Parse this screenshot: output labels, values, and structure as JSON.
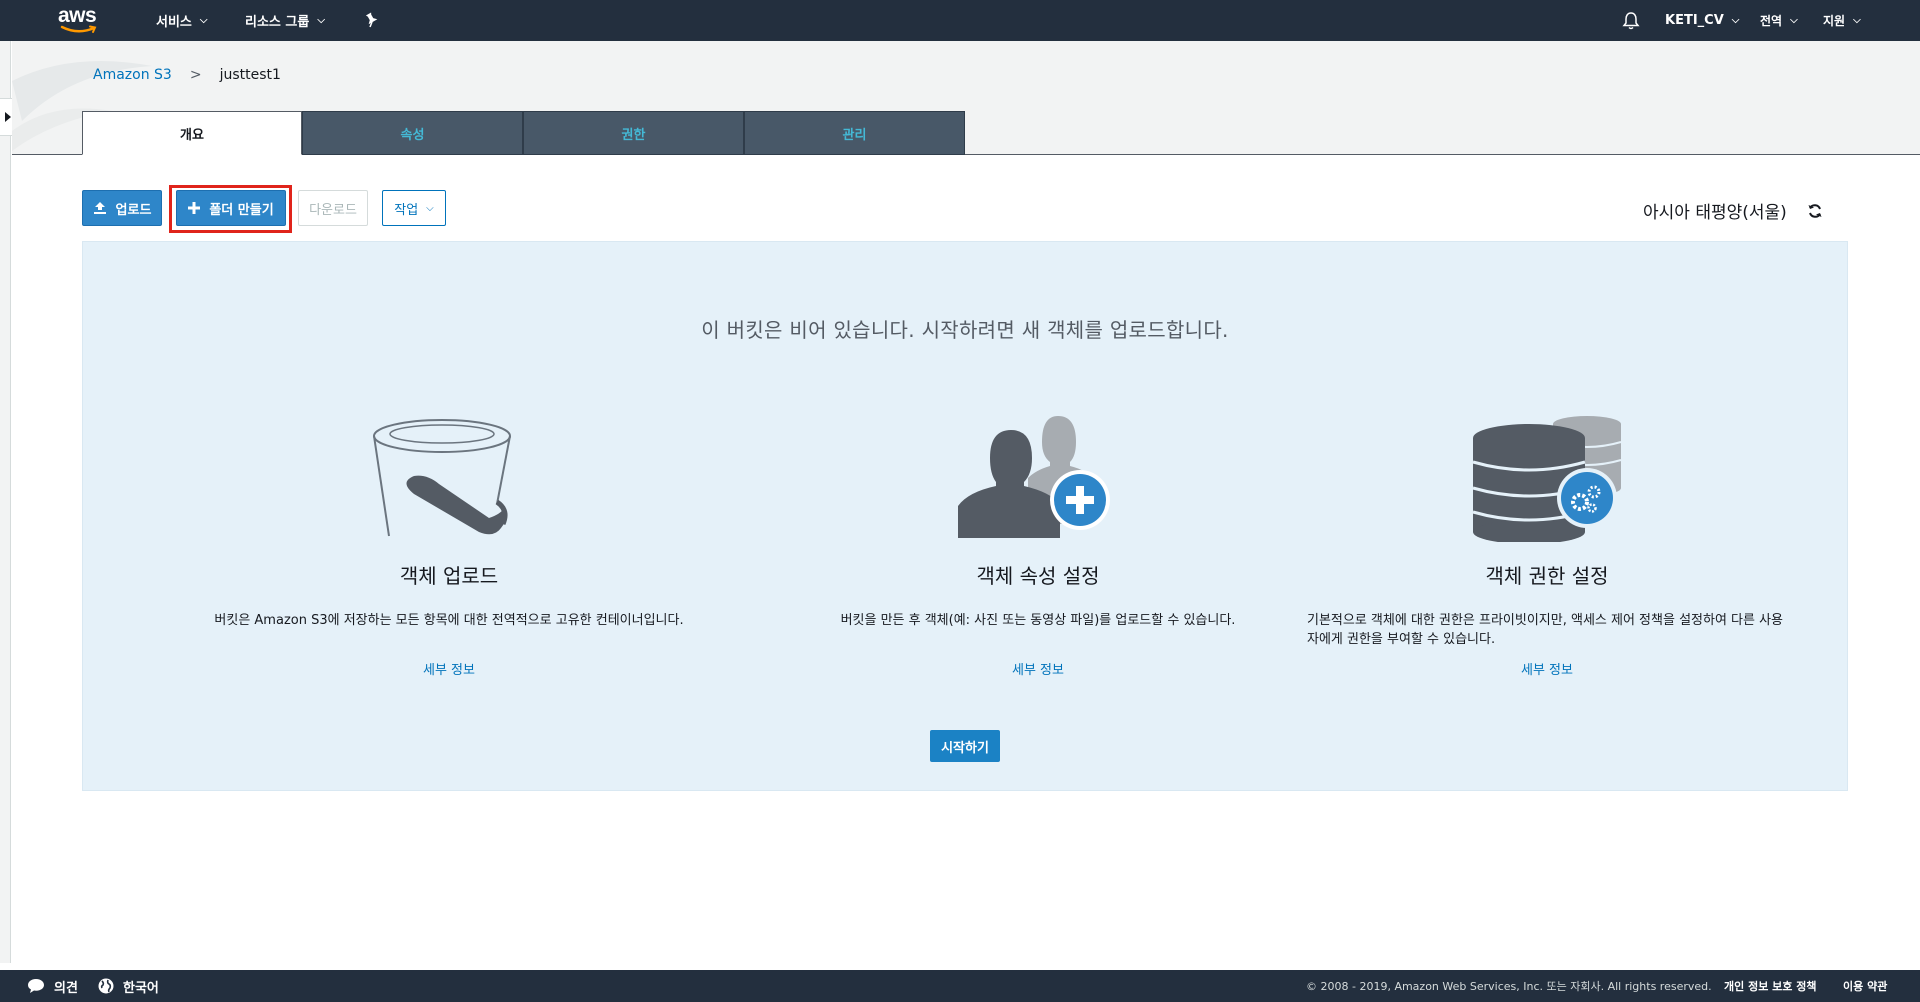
{
  "topnav": {
    "logo": "aws",
    "services": "서비스",
    "resource_groups": "리소스 그룹",
    "pin_icon": "pushpin-icon",
    "bell_icon": "bell-icon",
    "account": "KETI_CV",
    "region_menu": "전역",
    "support": "지원"
  },
  "breadcrumb": {
    "root": "Amazon S3",
    "separator": ">",
    "current": "justtest1"
  },
  "tabs": [
    {
      "label": "개요",
      "active": true
    },
    {
      "label": "속성",
      "active": false
    },
    {
      "label": "권한",
      "active": false
    },
    {
      "label": "관리",
      "active": false
    }
  ],
  "toolbar": {
    "upload": "업로드",
    "create_folder": "폴더 만들기",
    "download": "다운로드",
    "actions": "작업",
    "region": "아시아 태평양(서울)",
    "refresh_icon": "refresh-icon"
  },
  "panel": {
    "empty_message": "이 버킷은 비어 있습니다. 시작하려면 새 객체를 업로드합니다.",
    "features": [
      {
        "title": "객체 업로드",
        "description": "버킷은 Amazon S3에 저장하는 모든 항목에 대한 전역적으로 고유한 컨테이너입니다.",
        "link": "세부 정보",
        "icon": "bucket-icon"
      },
      {
        "title": "객체 속성 설정",
        "description": "버킷을 만든 후 객체(예: 사진 또는 동영상 파일)를 업로드할 수 있습니다.",
        "link": "세부 정보",
        "icon": "users-add-icon"
      },
      {
        "title": "객체 권한 설정",
        "description": "기본적으로 객체에 대한 권한은 프라이빗이지만, 액세스 제어 정책을 설정하여 다른 사용자에게 권한을 부여할 수 있습니다.",
        "link": "세부 정보",
        "icon": "database-settings-icon"
      }
    ],
    "start_button": "시작하기"
  },
  "footer": {
    "feedback": "의견",
    "language": "한국어",
    "copyright": "© 2008 - 2019, Amazon Web Services, Inc. 또는 자회사. All rights reserved.",
    "privacy": "개인 정보 보호 정책",
    "terms": "이용 약관"
  },
  "colors": {
    "nav_bg": "#232f3e",
    "accent_blue": "#2e86c9",
    "link_blue": "#0073bb",
    "panel_bg": "#e5f1f9",
    "highlight_red": "#e0241b"
  }
}
